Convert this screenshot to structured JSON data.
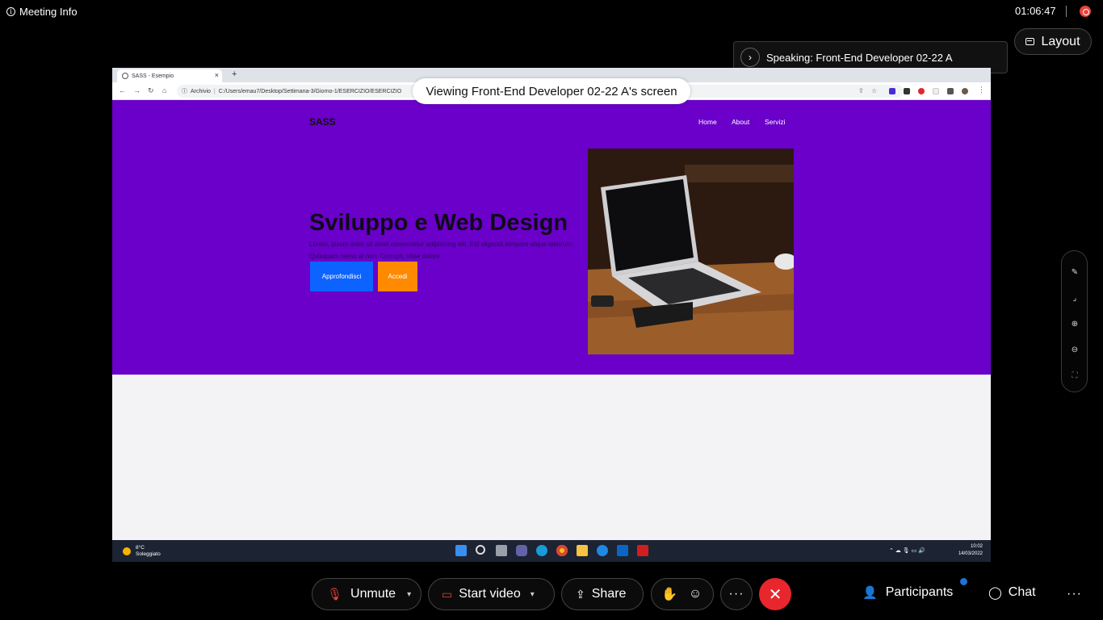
{
  "meeting": {
    "info_label": "Meeting Info",
    "timer": "01:06:47",
    "layout_label": "Layout",
    "speaking_text": "Speaking: Front-End Developer 02-22 A",
    "viewing_text": "Viewing Front-End Developer 02-22 A's screen"
  },
  "browser": {
    "tab_title": "SASS - Esempio",
    "close_glyph": "×",
    "newtab_glyph": "+",
    "site_info": "Archivio",
    "url": "C:/Users/emau7/Desktop/Settimana-3/Giorno-1/ESERCIZIO/ESERCIZIO"
  },
  "site": {
    "logo": "SASS",
    "nav": [
      "Home",
      "About",
      "Servizi"
    ],
    "hero_title": "Sviluppo e Web Design",
    "hero_text": "Lorem, ipsum dolor sit amet consectetur adipisicing elit. Est eligendi tempore atque laborum. Quisquam nemo at non. Corrupti, vitae dolore.",
    "btn_primary": "Approfondisci",
    "btn_secondary": "Accedi",
    "colors": {
      "hero_bg": "#6a00c9",
      "primary": "#0d63ff",
      "secondary": "#ff8a00"
    }
  },
  "taskbar": {
    "weather_temp": "8°C",
    "weather_desc": "Soleggiato",
    "time": "10:02",
    "date": "14/03/2022"
  },
  "controls": {
    "unmute": "Unmute",
    "start_video": "Start video",
    "share": "Share",
    "more": "···",
    "participants": "Participants",
    "chat": "Chat",
    "overflow": "···"
  },
  "colors": {
    "end_call": "#e8262e",
    "badge": "#1e73d6"
  }
}
